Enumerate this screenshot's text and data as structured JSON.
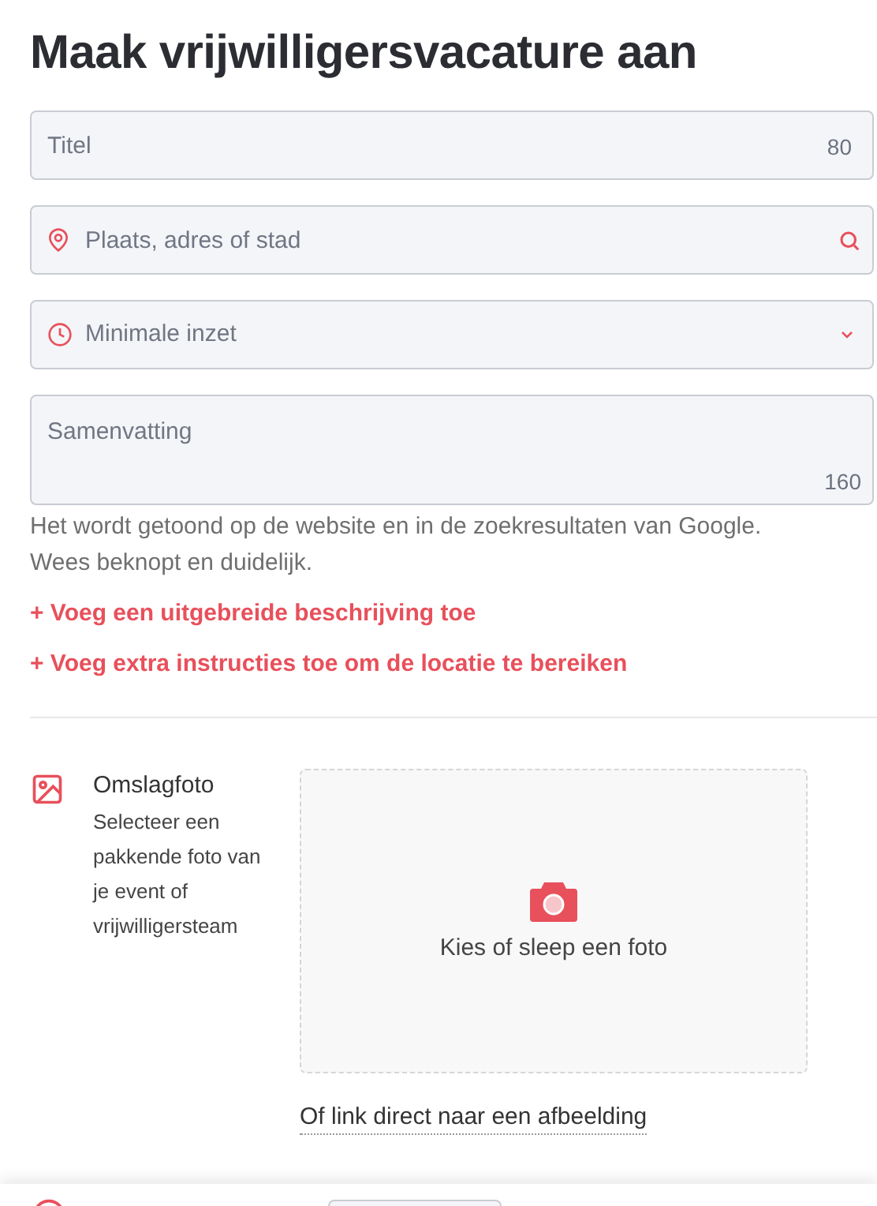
{
  "title": "Maak vrijwilligersvacature aan",
  "fields": [
    {
      "kind": "text",
      "placeholder": "Titel",
      "counter": "80"
    },
    {
      "kind": "location",
      "placeholder": "Plaats, adres of stad"
    },
    {
      "kind": "select",
      "placeholder": "Minimale inzet"
    },
    {
      "kind": "textarea",
      "placeholder": "Samenvatting",
      "counter": "160"
    }
  ],
  "help_text": [
    "Het wordt getoond op de website en in de zoekresultaten van Google.",
    "Wees beknopt en duidelijk."
  ],
  "links": [
    "+ Voeg een uitgebreide beschrijving toe",
    "+ Voeg extra instructies toe om de locatie te bereiken"
  ],
  "cover_photo": {
    "label": "Omslagfoto",
    "description": "Selecteer een pakkende foto van je event of vrijwilligersteam",
    "dropzone": "Kies of sleep een foto",
    "link": "Of link direct naar een afbeelding"
  }
}
